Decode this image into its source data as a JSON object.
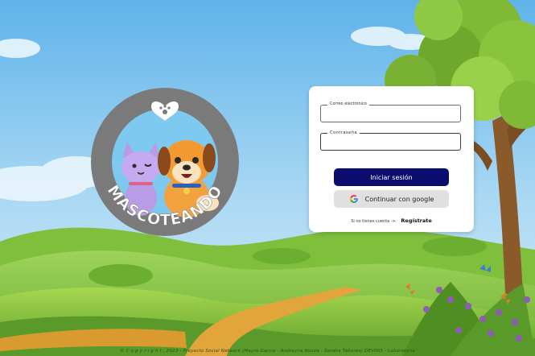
{
  "brand": {
    "name": "MASCOTEANDO",
    "letters": [
      "M",
      "A",
      "S",
      "C",
      "O",
      "T",
      "E",
      "A",
      "N",
      "D",
      "O"
    ]
  },
  "login": {
    "email_label": "Correo electrónico",
    "email_value": "",
    "password_label": "Contraseña",
    "password_value": "",
    "login_button": "Iniciar sesión",
    "google_button": "Continuar con google",
    "register_prompt": "Si no tienes cuenta  ->",
    "register_link": "Regístrate"
  },
  "footer": {
    "text": "© C o p y r i g h t , 2023 - Proyecto Social Network (Mayra Garcia - Andreyna Novoa - Sandra Tabares) DEV005 - Laboratoria"
  },
  "colors": {
    "primary_button": "#0a0c6e",
    "google_button": "#e0e0e0",
    "logo_ring": "#7a7a7a",
    "sky": "#8cc8ef",
    "grass": "#8dc63f"
  }
}
